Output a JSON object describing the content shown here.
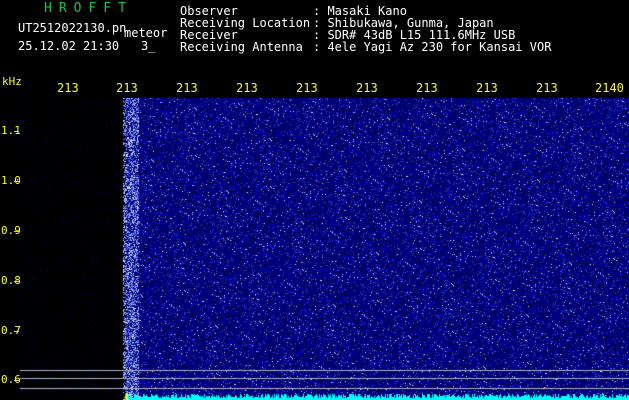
{
  "header": {
    "app_title": "HROFFT",
    "file_name": "UT2512022130.pn",
    "app_mode": "meteor",
    "date_time": "25.12.02 21:30",
    "counter": "3_",
    "info": [
      {
        "label": "Observer",
        "value": ": Masaki Kano"
      },
      {
        "label": "Receiving Location",
        "value": ": Shibukawa, Gunma, Japan"
      },
      {
        "label": "Receiver",
        "value": ": SDR# 43dB L15 111.6MHz USB"
      },
      {
        "label": "Receiving Antenna",
        "value": ": 4ele Yagi Az 230 for Kansai VOR"
      }
    ]
  },
  "axis": {
    "unit": "kHz",
    "time_ticks": [
      "213",
      "213",
      "213",
      "213",
      "213",
      "213",
      "213",
      "213",
      "213",
      "2140"
    ],
    "freq_ticks": [
      "1.1",
      "1.0",
      "0.9",
      "0.8",
      "0.7",
      "0.6"
    ]
  },
  "colors": {
    "title": "#19c24a",
    "tick_labels": "#ffff00",
    "noise_background": "#00008b",
    "noise_speckle": "#ffffff",
    "bottom_signal": "#00ffff"
  }
}
